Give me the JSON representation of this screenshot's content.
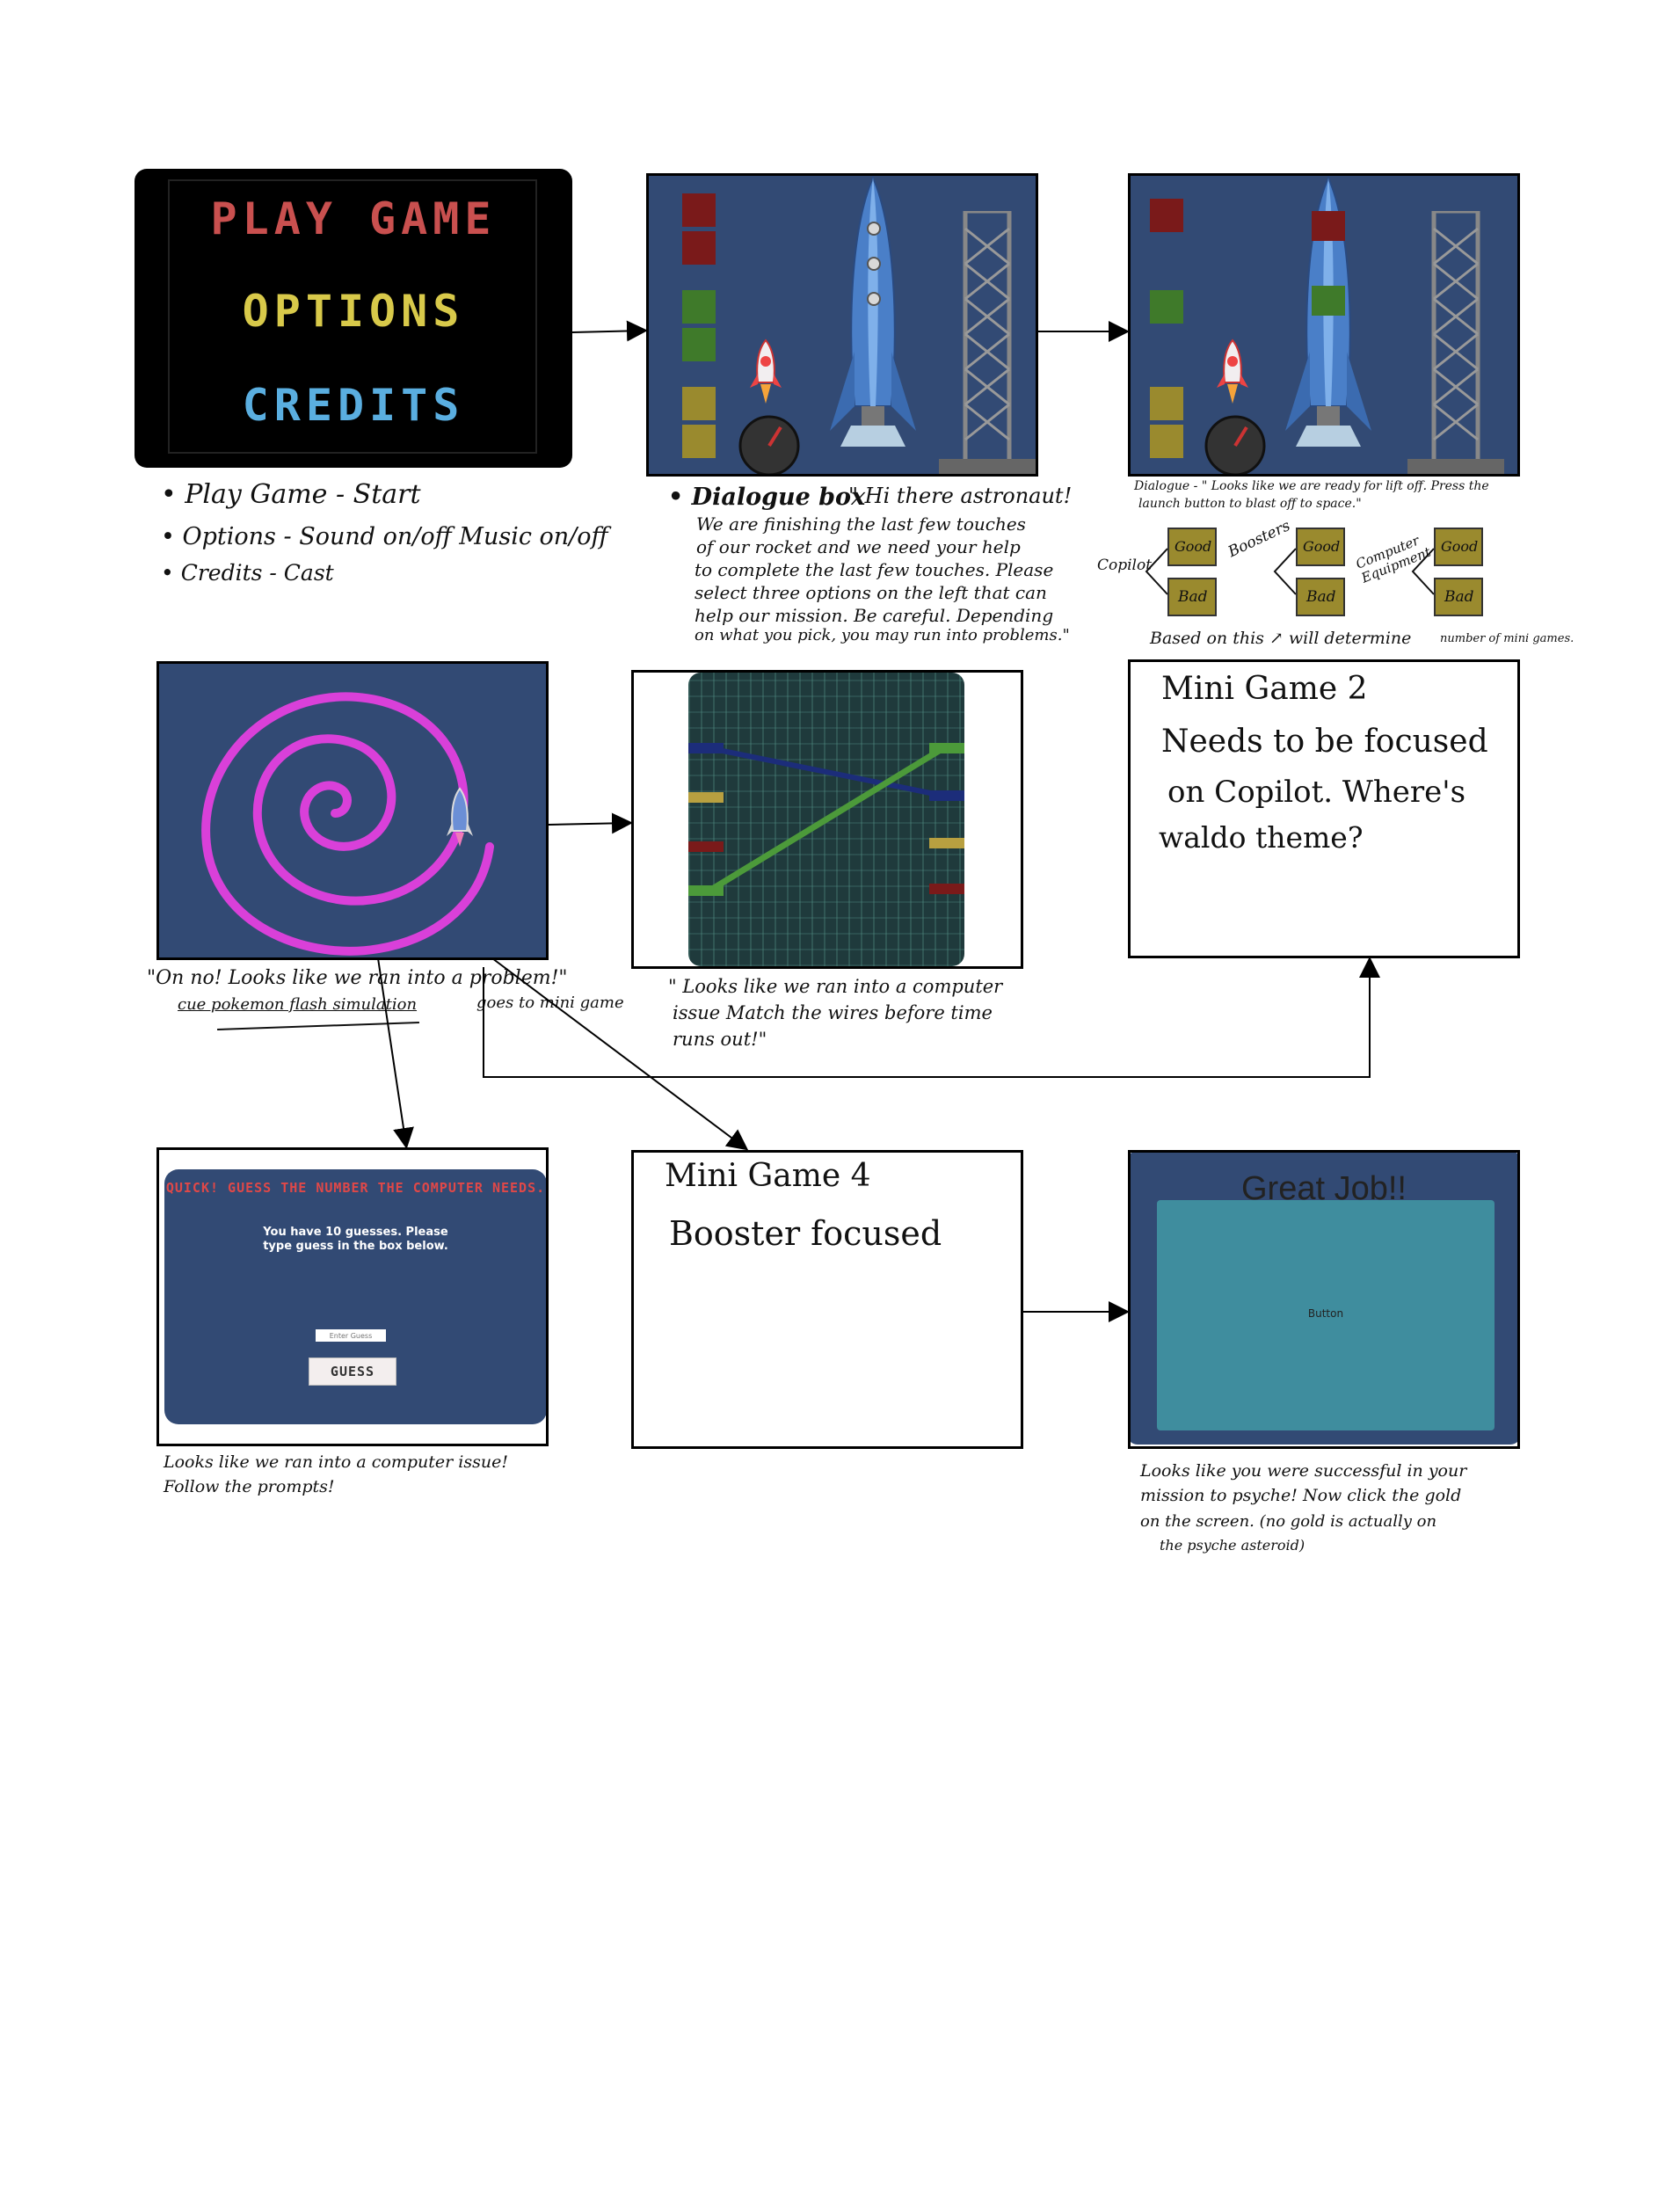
{
  "colors": {
    "navy": "#324a74",
    "dark_red": "#7a1a1a",
    "green": "#3f7a2a",
    "olive": "#9a8a2e",
    "spiral": "#d940d9",
    "teal": "#3f8d9e",
    "title_red": "#c9504f",
    "title_yellow": "#d8c94a",
    "title_blue": "#5aaee0"
  },
  "menu": {
    "play": "PLAY GAME",
    "options": "OPTIONS",
    "credits": "CREDITS"
  },
  "menu_notes": {
    "play": "• Play Game - Start",
    "options": "• Options - Sound on/off Music on/off",
    "credits": "• Credits - Cast"
  },
  "dialogue1": {
    "heading": "• Dialogue box",
    "lines": [
      "\" Hi there astronaut!",
      "We are finishing the last few touches",
      "of our rocket and we need your help",
      "to complete the last few touches. Please",
      "select three options on the left that can",
      "help our mission. Be careful. Depending",
      "on what you pick, you may run into problems.\""
    ]
  },
  "dialogue2": {
    "lines": [
      "Dialogue - \" Looks like we are ready for lift off. Press the",
      "launch button to blast off to space.\""
    ]
  },
  "choices": {
    "groups": [
      {
        "label": "Copilot",
        "good": "Good",
        "bad": "Bad"
      },
      {
        "label": "Boosters",
        "good": "Good",
        "bad": "Bad"
      },
      {
        "label": "Computer Equipment",
        "good": "Good",
        "bad": "Bad"
      }
    ],
    "note_main": "Based on this ↗ will determine",
    "note_small": "number of mini games."
  },
  "spiral_note": {
    "line1": "\"On no! Looks like we ran into a problem!\"",
    "line2": "cue pokemon flash simulation",
    "line3": "goes to mini game"
  },
  "wires_note": {
    "lines": [
      "\" Looks like we ran into a computer",
      "issue Match the wires before time",
      "runs out!\""
    ]
  },
  "mini2": {
    "lines": [
      "Mini Game 2",
      "Needs to be focused",
      "on Copilot. Where's",
      "waldo theme?"
    ]
  },
  "guess": {
    "title": "QUICK! GUESS THE NUMBER THE COMPUTER NEEDS.",
    "line1": "You have 10 guesses. Please",
    "line2": "type guess in the box below.",
    "placeholder": "Enter Guess",
    "button": "GUESS"
  },
  "guess_note": {
    "line1": "Looks like we ran into a computer issue!",
    "line2": "Follow the prompts!"
  },
  "mini4": {
    "line1": "Mini Game 4",
    "line2": "Booster focused"
  },
  "greatjob": {
    "title": "Great Job!!",
    "button": "Button"
  },
  "final_note": {
    "lines": [
      "Looks like you were successful in your",
      "mission to psyche! Now click the gold",
      "on the screen. (no gold is actually on",
      "the psyche asteroid)"
    ]
  }
}
